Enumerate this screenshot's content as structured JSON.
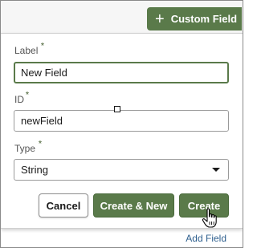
{
  "toolbar": {
    "custom_field_icon": "+",
    "custom_field_label": "Custom Field"
  },
  "form": {
    "label_field": {
      "label": "Label",
      "required_marker": "*",
      "value": "New Field"
    },
    "id_field": {
      "label": "ID",
      "required_marker": "*",
      "value": "newField"
    },
    "type_field": {
      "label": "Type",
      "required_marker": "*",
      "selected": "String"
    }
  },
  "actions": {
    "cancel_label": "Cancel",
    "create_new_label": "Create & New",
    "create_label": "Create"
  },
  "footer": {
    "add_field_label": "Add Field"
  },
  "colors": {
    "primary": "#5a7a4a",
    "link": "#2e5f8e"
  }
}
